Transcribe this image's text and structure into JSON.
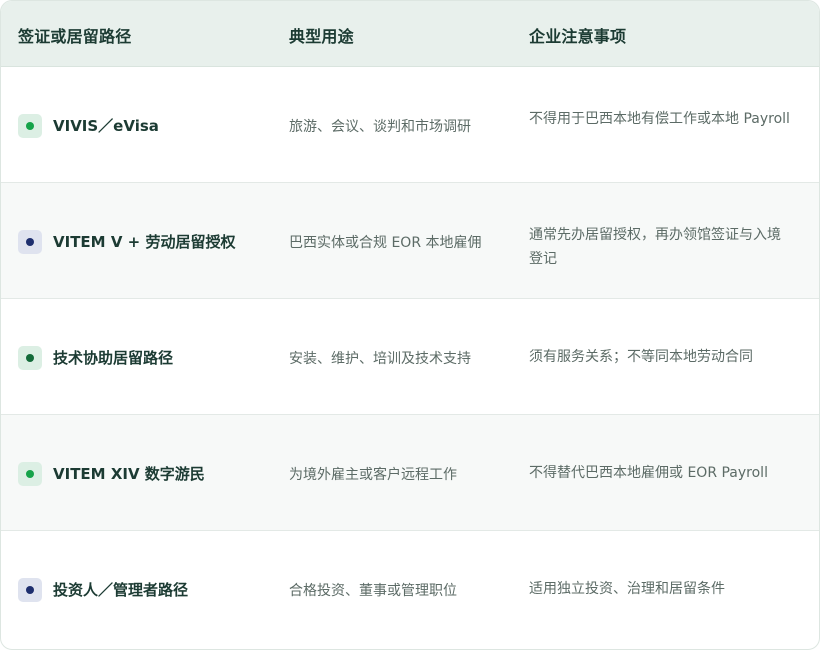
{
  "header": {
    "col_route": "签证或居留路径",
    "col_usage": "典型用途",
    "col_notes": "企业注意事项"
  },
  "colors": {
    "green_dot": "#16a34a",
    "green_bg": "#dcefe4",
    "navy_dot": "#1e2f6e",
    "navy_bg": "#dfe3ef",
    "darkgreen_dot": "#146b3a"
  },
  "rows": [
    {
      "route": "VIVIS／eVisa",
      "usage": "旅游、会议、谈判和市场调研",
      "notes": "不得用于巴西本地有偿工作或本地 Payroll",
      "marker": "green"
    },
    {
      "route": "VITEM V + 劳动居留授权",
      "usage": "巴西实体或合规 EOR 本地雇佣",
      "notes": "通常先办居留授权，再办领馆签证与入境登记",
      "marker": "navy"
    },
    {
      "route": "技术协助居留路径",
      "usage": "安装、维护、培训及技术支持",
      "notes": "须有服务关系；不等同本地劳动合同",
      "marker": "darkgreen"
    },
    {
      "route": "VITEM XIV 数字游民",
      "usage": "为境外雇主或客户远程工作",
      "notes": "不得替代巴西本地雇佣或 EOR Payroll",
      "marker": "green"
    },
    {
      "route": "投资人／管理者路径",
      "usage": "合格投资、董事或管理职位",
      "notes": "适用独立投资、治理和居留条件",
      "marker": "navy"
    }
  ]
}
